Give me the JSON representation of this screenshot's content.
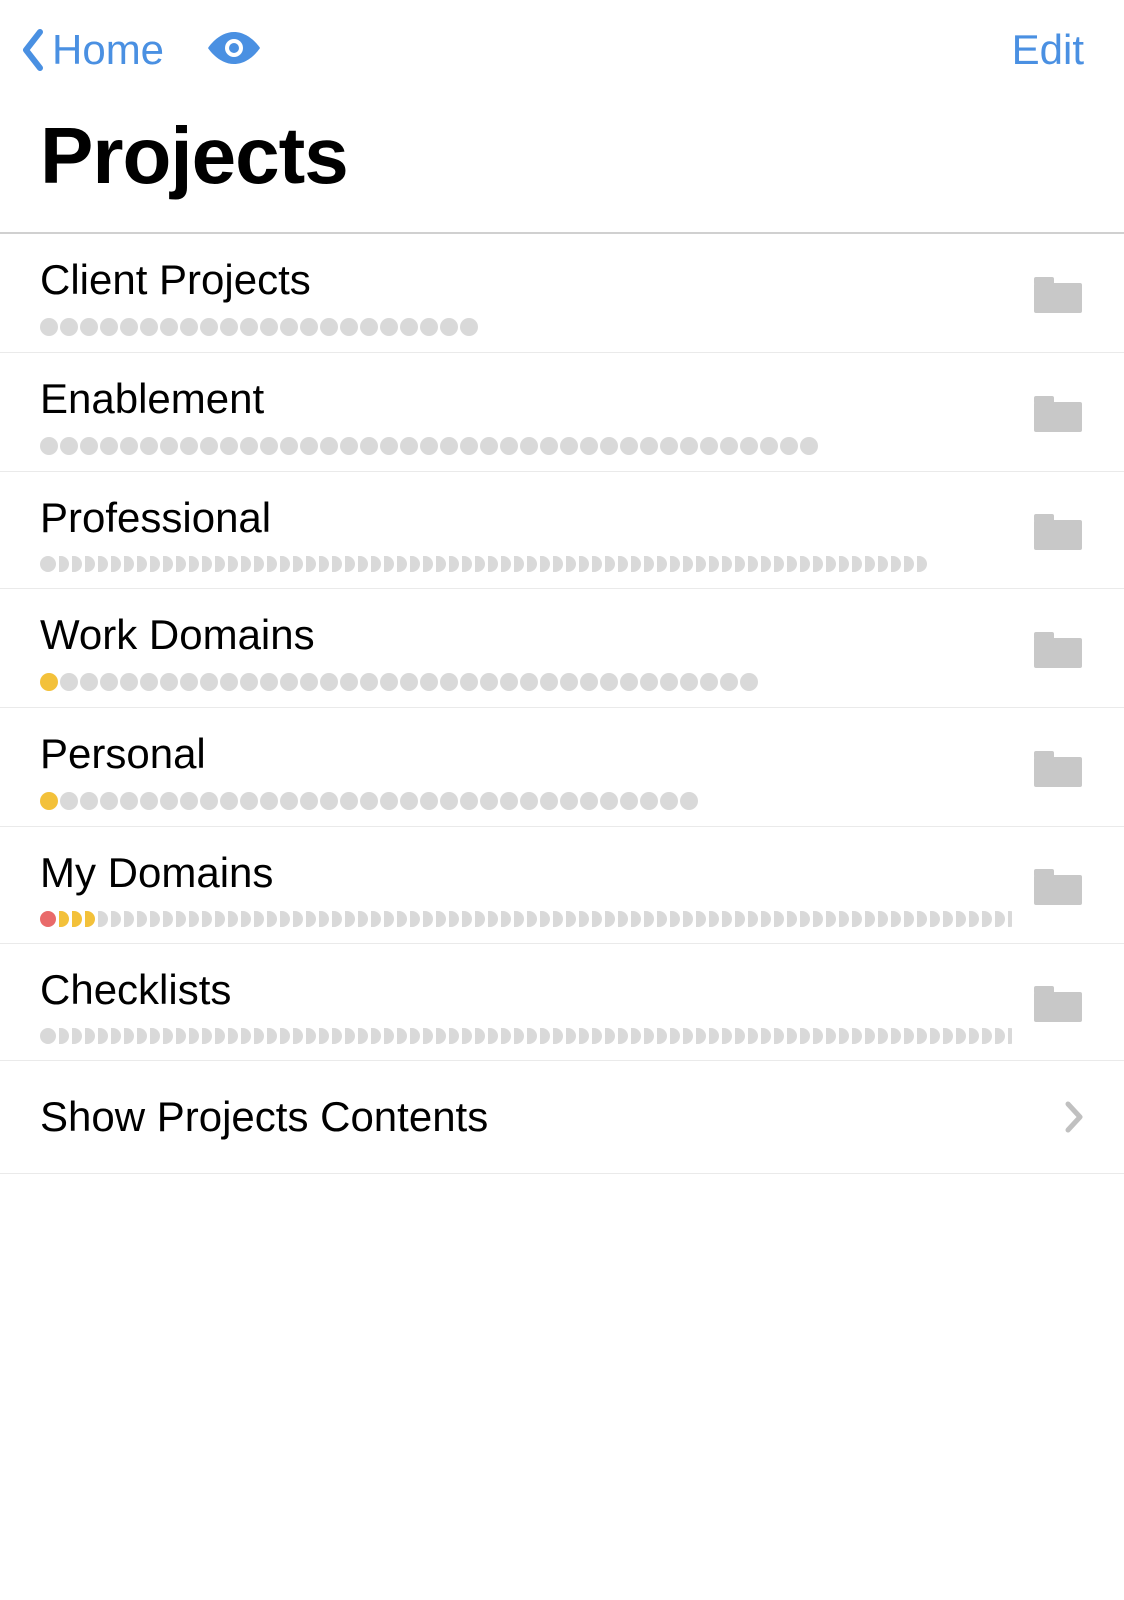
{
  "nav": {
    "back_label": "Home",
    "edit_label": "Edit"
  },
  "page": {
    "title": "Projects",
    "action_label": "Show Projects Contents"
  },
  "colors": {
    "tint": "#4a90e2",
    "gray": "#d9d9d9",
    "yellow": "#f3c13a",
    "red": "#e96a6a",
    "folder": "#c8c8c8"
  },
  "projects": [
    {
      "name": "Client Projects",
      "marker_shape": "circle",
      "marker_size": 18,
      "markers": [
        {
          "color": "gray",
          "count": 22
        }
      ]
    },
    {
      "name": "Enablement",
      "marker_shape": "circle",
      "marker_size": 18,
      "markers": [
        {
          "color": "gray",
          "count": 39
        }
      ]
    },
    {
      "name": "Professional",
      "marker_shape": "chip",
      "marker_size": 16,
      "markers": [
        {
          "color": "gray",
          "count": 68
        }
      ]
    },
    {
      "name": "Work Domains",
      "marker_shape": "circle",
      "marker_size": 18,
      "markers": [
        {
          "color": "yellow",
          "count": 1
        },
        {
          "color": "gray",
          "count": 35
        }
      ]
    },
    {
      "name": "Personal",
      "marker_shape": "circle",
      "marker_size": 18,
      "markers": [
        {
          "color": "yellow",
          "count": 1
        },
        {
          "color": "gray",
          "count": 32
        }
      ]
    },
    {
      "name": "My Domains",
      "marker_shape": "chip",
      "marker_size": 16,
      "markers": [
        {
          "color": "red",
          "count": 1
        },
        {
          "color": "yellow",
          "count": 3
        },
        {
          "color": "gray",
          "count": 75
        }
      ]
    },
    {
      "name": "Checklists",
      "marker_shape": "chip",
      "marker_size": 16,
      "markers": [
        {
          "color": "gray",
          "count": 78
        }
      ]
    }
  ]
}
